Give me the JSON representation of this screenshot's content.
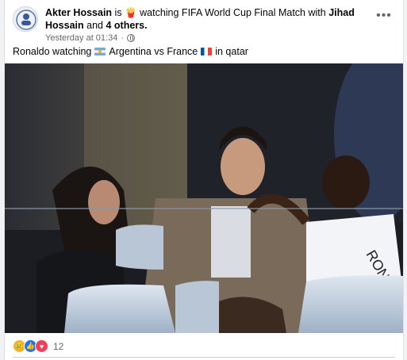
{
  "post": {
    "author": "Akter Hossain",
    "is_word": "is",
    "activity_emoji": "🍟",
    "activity_text": "watching FIFA World Cup Final Match with",
    "tagged_person": "Jihad Hossain",
    "and_word": "and",
    "others": "4 others.",
    "timestamp": "Yesterday at 01:34",
    "separator": "·",
    "privacy_icon": "globe-icon",
    "more_label": "•••",
    "text_part1": "Ronaldo watching",
    "text_part2": "Argentina vs France",
    "text_part3": "in qatar",
    "flag1": "argentina-flag",
    "flag2": "france-flag",
    "photo_desc_icon": "photo"
  },
  "reactions": {
    "icons": [
      "sad-icon",
      "like-icon",
      "love-icon"
    ],
    "sad": "😢",
    "like": "👍",
    "love": "♥",
    "count": "12"
  },
  "colors": {
    "like": "#1877f2",
    "love": "#f33e58",
    "sad": "#f7b125",
    "meta_text": "#65676b"
  }
}
